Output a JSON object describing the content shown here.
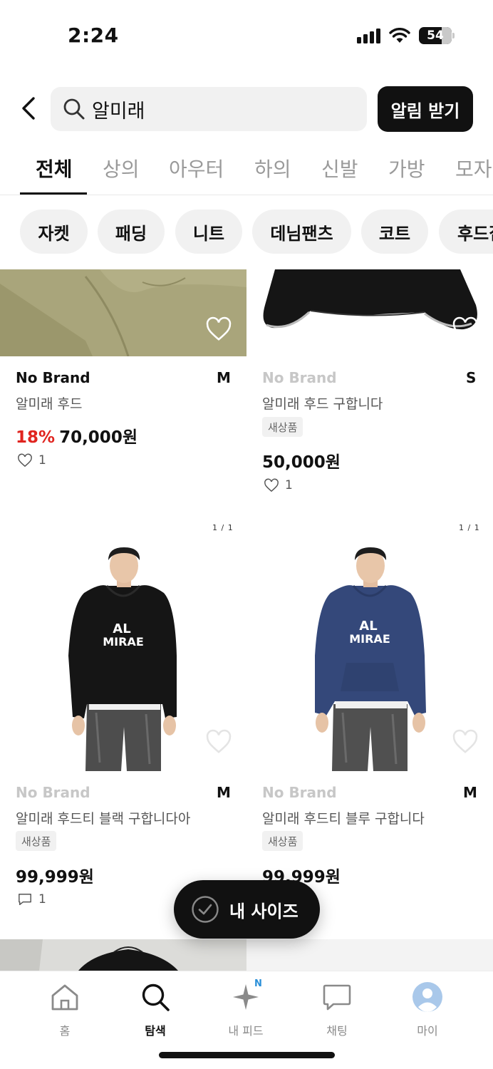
{
  "status_bar": {
    "time": "2:24",
    "battery": "54"
  },
  "header": {
    "search_value": "알미래",
    "alert_button": "알림 받기"
  },
  "tabs": [
    "전체",
    "상의",
    "아우터",
    "하의",
    "신발",
    "가방",
    "모자"
  ],
  "chips": [
    "자켓",
    "패딩",
    "니트",
    "데님팬츠",
    "코트",
    "후드집업"
  ],
  "products": [
    {
      "brand": "No Brand",
      "size": "M",
      "title": "알미래 후드",
      "discount": "18%",
      "price": "70,000원",
      "likes": "1"
    },
    {
      "brand": "No Brand",
      "size": "S",
      "title": "알미래 후드 구합니다",
      "badge": "새상품",
      "price": "50,000원",
      "likes": "1"
    },
    {
      "brand": "No Brand",
      "size": "M",
      "title": "알미래 후드티 블랙 구합니다아",
      "badge": "새상품",
      "price": "99,999원",
      "comments": "1",
      "page": "1 / 1"
    },
    {
      "brand": "No Brand",
      "size": "M",
      "title": "알미래 후드티 블루 구합니다",
      "badge": "새상품",
      "price": "99,999원",
      "page": "1 / 1"
    }
  ],
  "hoodie_print": {
    "line1": "AL",
    "line2": "MIRAE"
  },
  "floating": {
    "my_size": "내 사이즈"
  },
  "nav": [
    {
      "label": "홈",
      "icon": "home-icon"
    },
    {
      "label": "탐색",
      "icon": "search-icon"
    },
    {
      "label": "내 피드",
      "icon": "sparkle-icon",
      "badge": "N"
    },
    {
      "label": "채팅",
      "icon": "chat-icon"
    },
    {
      "label": "마이",
      "icon": "avatar-icon"
    }
  ],
  "colors": {
    "accent": "#111111",
    "discount": "#e0241f",
    "feed_badge": "#2a8fd8",
    "chip_bg": "#f1f1f1"
  }
}
